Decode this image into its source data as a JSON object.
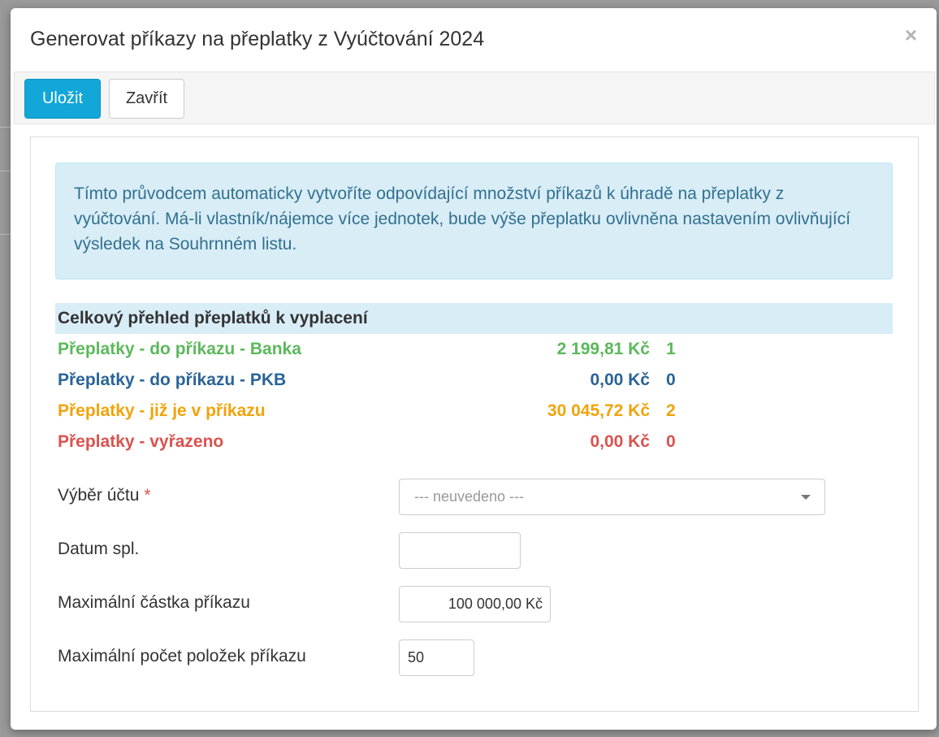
{
  "dialog": {
    "title": "Generovat příkazy na přeplatky z Vyúčtování 2024",
    "close_symbol": "×"
  },
  "toolbar": {
    "save_label": "Uložit",
    "close_label": "Zavřít"
  },
  "info": {
    "text": "Tímto průvodcem automaticky vytvoříte odpovídající množství příkazů k úhradě na přeplatky z vyúčtování. Má-li vlastník/nájemce více jednotek, bude výše přeplatku ovlivněna nastavením ovlivňující výsledek na Souhrnném listu."
  },
  "summary": {
    "header": "Celkový přehled přeplatků k vyplacení",
    "rows": [
      {
        "label": "Přeplatky - do příkazu - Banka",
        "amount": "2 199,81 Kč",
        "count": "1",
        "color": "#5cb85c"
      },
      {
        "label": "Přeplatky - do příkazu - PKB",
        "amount": "0,00 Kč",
        "count": "0",
        "color": "#2a6496"
      },
      {
        "label": "Přeplatky - již je v příkazu",
        "amount": "30 045,72 Kč",
        "count": "2",
        "color": "#f0a30a"
      },
      {
        "label": "Přeplatky - vyřazeno",
        "amount": "0,00 Kč",
        "count": "0",
        "color": "#d9534f"
      }
    ]
  },
  "form": {
    "account_label": "Výběr účtu",
    "required_marker": "*",
    "account_value": "--- neuvedeno ---",
    "date_label": "Datum spl.",
    "date_value": "",
    "max_amount_label": "Maximální částka příkazu",
    "max_amount_value": "100 000,00 Kč",
    "max_items_label": "Maximální počet položek příkazu",
    "max_items_value": "50"
  },
  "colors": {
    "primary": "#12a7d8",
    "info_bg": "#d9edf7",
    "info_text": "#31708f"
  }
}
